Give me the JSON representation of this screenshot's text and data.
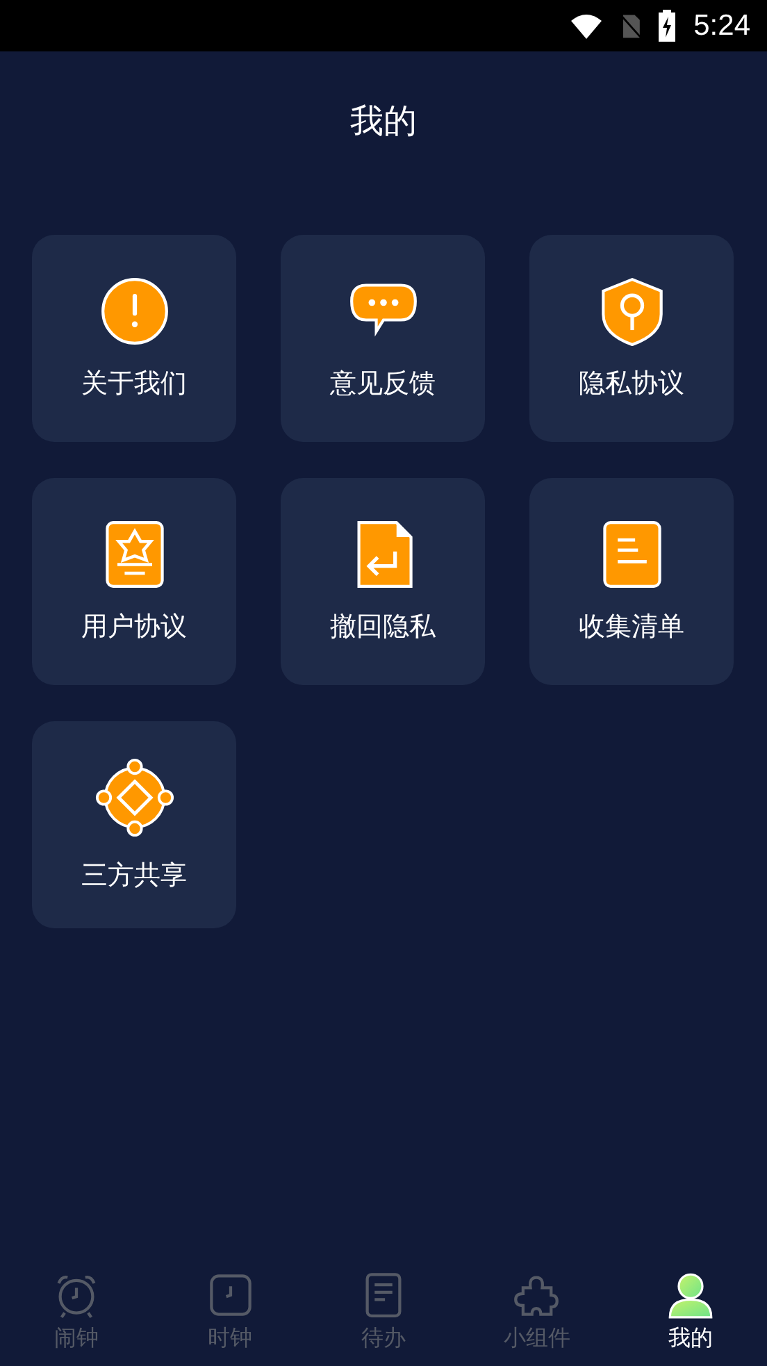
{
  "status_bar": {
    "time": "5:24"
  },
  "header": {
    "title": "我的"
  },
  "menu": [
    {
      "label": "关于我们",
      "kind": "info"
    },
    {
      "label": "意见反馈",
      "kind": "chat"
    },
    {
      "label": "隐私协议",
      "kind": "shield"
    },
    {
      "label": "用户协议",
      "kind": "badge"
    },
    {
      "label": "撤回隐私",
      "kind": "return"
    },
    {
      "label": "收集清单",
      "kind": "list"
    },
    {
      "label": "三方共享",
      "kind": "share"
    }
  ],
  "tabs": [
    {
      "label": "闹钟",
      "kind": "alarm",
      "selected": false
    },
    {
      "label": "时钟",
      "kind": "clock",
      "selected": false
    },
    {
      "label": "待办",
      "kind": "todo",
      "selected": false
    },
    {
      "label": "小组件",
      "kind": "widget",
      "selected": false
    },
    {
      "label": "我的",
      "kind": "user",
      "selected": true
    }
  ]
}
